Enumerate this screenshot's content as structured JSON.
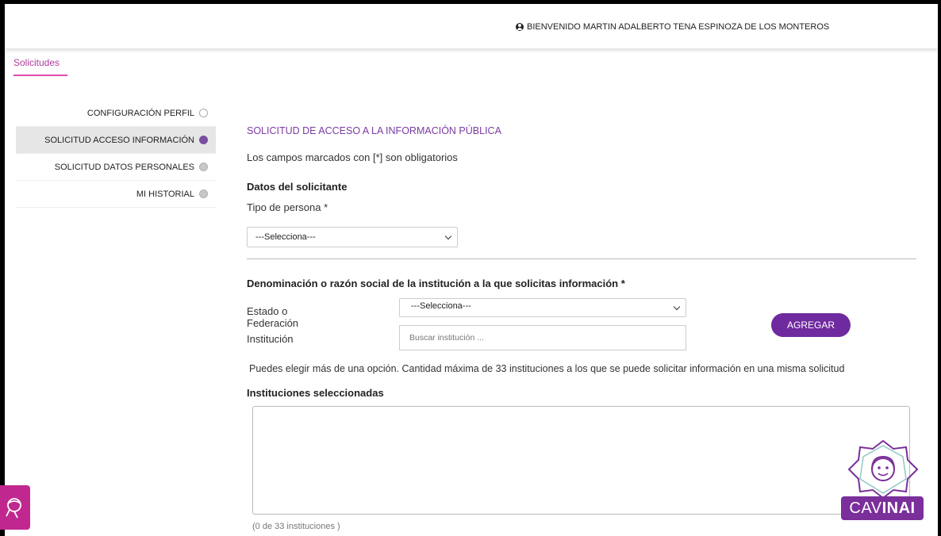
{
  "header": {
    "welcome_text": "BIENVENIDO MARTIN ADALBERTO TENA ESPINOZA DE LOS MONTEROS"
  },
  "tabs": [
    {
      "label": "Solicitudes"
    }
  ],
  "sidebar": {
    "items": [
      {
        "label": "CONFIGURACIÓN PERFIL",
        "active": false
      },
      {
        "label": "SOLICITUD ACCESO INFORMACIÓN",
        "active": true
      },
      {
        "label": "SOLICITUD DATOS PERSONALES",
        "active": false
      },
      {
        "label": "MI HISTORIAL",
        "active": false
      }
    ]
  },
  "form": {
    "title": "SOLICITUD DE ACCESO A LA INFORMACIÓN PÚBLICA",
    "required_note": "Los campos marcados con [*] son obligatorios",
    "section_solicitante": "Datos del solicitante",
    "tipo_persona_label": "Tipo de persona *",
    "tipo_persona_value": "---Selecciona---",
    "section_institucion": "Denominación o razón social de la institución a la que solicitas información *",
    "estado_label": "Estado o Federación",
    "estado_value": "---Selecciona---",
    "institucion_label": "Institución",
    "institucion_placeholder": "Buscar institución ...",
    "agregar_button": "AGREGAR",
    "hint": "Puedes elegir más de una opción. Cantidad máxima de 33 instituciones a los que se puede solicitar información en una misma solicitud",
    "selected_heading": "Instituciones seleccionadas",
    "counter": "(0 de 33 instituciones )"
  },
  "widgets": {
    "cav_logo_text_a": "CAV",
    "cav_logo_text_b": "INAI"
  },
  "colors": {
    "accent_purple": "#6f2a9f",
    "title_purple": "#7a3aa0",
    "tab_pink": "#e04bb0",
    "chat_magenta": "#c0288f"
  }
}
